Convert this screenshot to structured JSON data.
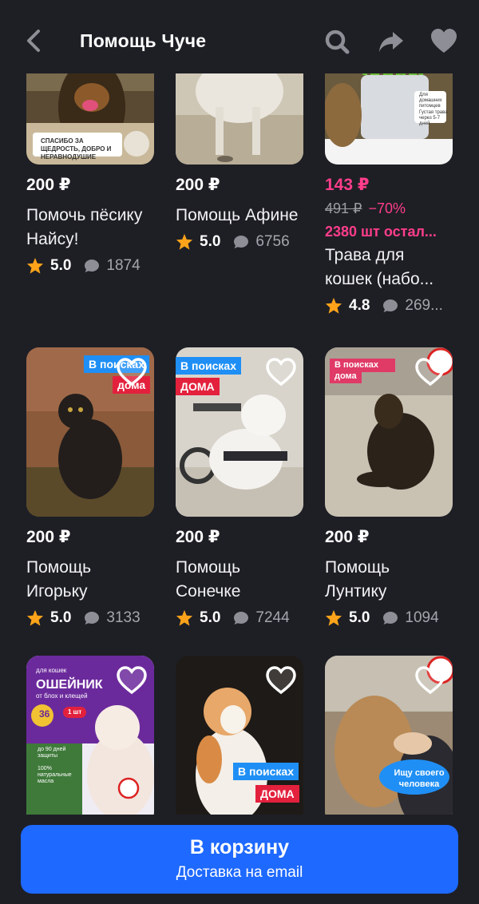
{
  "header": {
    "title": "Помощь Чуче"
  },
  "products": [
    {
      "price": "200 ₽",
      "name": "Помочь пёсику Найсу!",
      "rating": "5.0",
      "reviews": "1874",
      "banner": "СПАСИБО ЗА ЩЕДРОСТЬ, ДОБРО И НЕРАВНОДУШИЕ"
    },
    {
      "price": "200 ₽",
      "name": "Помощь Афине",
      "rating": "5.0",
      "reviews": "6756"
    },
    {
      "price": "143 ₽",
      "old_price": "491 ₽",
      "discount": "−70%",
      "stock": "2380 шт остал...",
      "name": "Трава для кошек (набо...",
      "rating": "4.8",
      "reviews": "269...",
      "banner_line1": "Для домашних питомцев",
      "banner_line2": "Густая трава через 5-7 дней"
    },
    {
      "price": "200 ₽",
      "name": "Помощь Игорьку",
      "rating": "5.0",
      "reviews": "3133",
      "tag_line1": "В поисках",
      "tag_line2": "дома"
    },
    {
      "price": "200 ₽",
      "name": "Помощь Сонечке",
      "rating": "5.0",
      "reviews": "7244",
      "tag_line1": "В поисках",
      "tag_line2": "ДОМА"
    },
    {
      "price": "200 ₽",
      "name": "Помощь Лунтику",
      "rating": "5.0",
      "reviews": "1094",
      "tag_line1": "В поисках",
      "tag_line2": "дома"
    },
    {
      "badge_top": "для кошек",
      "badge_title": "ОШЕЙНИК",
      "badge_sub": "от блох и клещей",
      "badge_size": "36",
      "badge_count": "1 шт",
      "badge_f1": "до 90 дней защиты",
      "badge_f2": "100% натуральные масла"
    },
    {
      "tag_line1": "В поисках",
      "tag_line2": "ДОМА"
    },
    {
      "bubble": "Ищу своего человека"
    }
  ],
  "cta": {
    "label": "В корзину",
    "sublabel": "Доставка на email"
  },
  "colors": {
    "background": "#1e1f25",
    "accent": "#1e69ff",
    "sale": "#ff3d8b",
    "star": "#ffa31a"
  }
}
